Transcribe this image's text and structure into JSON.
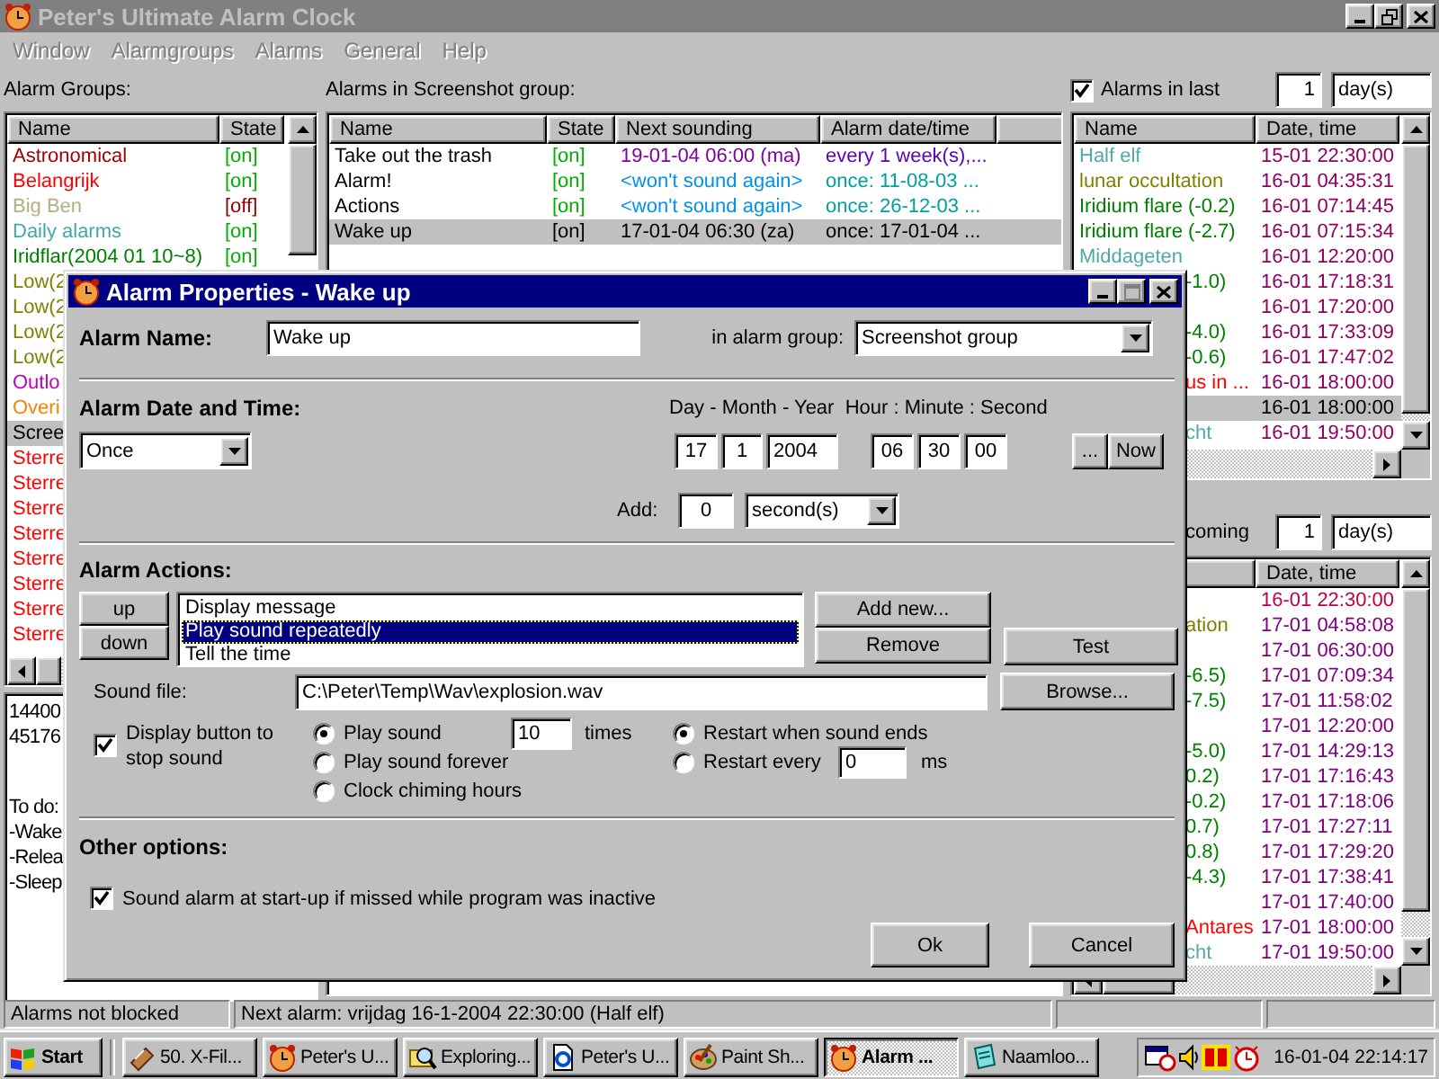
{
  "window": {
    "title": "Peter's Ultimate Alarm Clock",
    "active": false
  },
  "menu": [
    {
      "label": "Window",
      "disabled": true
    },
    {
      "label": "Alarmgroups",
      "disabled": true
    },
    {
      "label": "Alarms",
      "disabled": true
    },
    {
      "label": "General",
      "disabled": true
    },
    {
      "label": "Help",
      "disabled": true
    }
  ],
  "groups": {
    "label": "Alarm Groups:",
    "columns": [
      "Name",
      "State"
    ],
    "items": [
      {
        "name": "Astronomical",
        "color": "#a00000",
        "state": "[on]",
        "on": true,
        "selected": false
      },
      {
        "name": "Belangrijk",
        "color": "#ff0000",
        "state": "[on]",
        "on": true,
        "selected": false
      },
      {
        "name": "Big Ben",
        "color": "#b0b080",
        "state": "[off]",
        "on": false,
        "selected": false
      },
      {
        "name": "Daily alarms",
        "color": "#40a8a8",
        "state": "[on]",
        "on": true,
        "selected": false
      },
      {
        "name": "Iridflar(2004 01 10~8)",
        "color": "#008000",
        "state": "[on]",
        "on": true,
        "selected": false
      },
      {
        "name": "Low(2",
        "color": "#808000",
        "selected": false
      },
      {
        "name": "Low(2",
        "color": "#808000",
        "selected": false
      },
      {
        "name": "Low(2",
        "color": "#808000",
        "selected": false
      },
      {
        "name": "Low(2",
        "color": "#808000",
        "selected": false
      },
      {
        "name": "Outlo",
        "color": "#c000c0",
        "selected": false
      },
      {
        "name": "Overi",
        "color": "#ff8000",
        "selected": false
      },
      {
        "name": "Scree",
        "color": "#000000",
        "selected": true
      },
      {
        "name": "Sterre",
        "color": "#ff0000",
        "selected": false
      },
      {
        "name": "Sterre",
        "color": "#ff0000",
        "selected": false
      },
      {
        "name": "Sterre",
        "color": "#ff0000",
        "selected": false
      },
      {
        "name": "Sterre",
        "color": "#ff0000",
        "selected": false
      },
      {
        "name": "Sterre",
        "color": "#ff0000",
        "selected": false
      },
      {
        "name": "Sterre",
        "color": "#ff0000",
        "selected": false
      },
      {
        "name": "Sterre",
        "color": "#ff0000",
        "selected": false
      },
      {
        "name": "Sterre",
        "color": "#ff0000",
        "selected": false
      }
    ]
  },
  "notes": [
    [
      "14400",
      "45176"
    ],
    [
      "To do:",
      "-Wake",
      "-Relea",
      "-Sleep"
    ]
  ],
  "alarms": {
    "label": "Alarms in Screenshot group:",
    "columns": [
      "Name",
      "State",
      "Next sounding",
      "Alarm date/time"
    ],
    "rows": [
      {
        "name": "Take out the trash",
        "state": "[on]",
        "on": true,
        "next": {
          "text": "19-01-04 06:00 (ma)",
          "color": "#8000a0"
        },
        "date": {
          "text": "every 1 week(s),...",
          "color": "#6000c0"
        },
        "selected": false
      },
      {
        "name": "Alarm!",
        "state": "[on]",
        "on": true,
        "next": {
          "text": "<won't sound again>",
          "color": "#0090f0"
        },
        "date": {
          "text": "once: 11-08-03 ...",
          "color": "#00a0a0"
        },
        "selected": false
      },
      {
        "name": "Actions",
        "state": "[on]",
        "on": true,
        "next": {
          "text": "<won't sound again>",
          "color": "#0090f0"
        },
        "date": {
          "text": "once: 26-12-03 ...",
          "color": "#00a0a0"
        },
        "selected": false
      },
      {
        "name": "Wake up",
        "state": "[on]",
        "on": true,
        "next": {
          "text": "17-01-04 06:30 (za)",
          "color": "#000000"
        },
        "date": {
          "text": "once: 17-01-04 ...",
          "color": "#000000"
        },
        "selected": true
      }
    ]
  },
  "recent": {
    "checked": true,
    "label": "Alarms in last",
    "count": "1",
    "unit": "day(s)",
    "columns": [
      "Name",
      "Date, time"
    ],
    "rows": [
      {
        "name": "Half elf",
        "color": "#50a8a8",
        "time": {
          "text": "15-01 22:30:00",
          "color": "#900060"
        },
        "selected": false
      },
      {
        "name": "lunar occultation",
        "color": "#808000",
        "time": {
          "text": "16-01 04:35:31",
          "color": "#900060"
        },
        "selected": false
      },
      {
        "name": "Iridium flare (-0.2)",
        "color": "#008000",
        "time": {
          "text": "16-01 07:14:45",
          "color": "#900060"
        },
        "selected": false
      },
      {
        "name": "Iridium flare (-2.7)",
        "color": "#008000",
        "time": {
          "text": "16-01 07:15:34",
          "color": "#900060"
        },
        "selected": false
      },
      {
        "name": "Middageten",
        "color": "#50a8a8",
        "time": {
          "text": "16-01 12:20:00",
          "color": "#900060"
        },
        "selected": false
      },
      {
        "name": "-1.0)",
        "color": "#008000",
        "time": {
          "text": "16-01 17:18:31",
          "color": "#900060"
        },
        "selected": false
      },
      {
        "time": {
          "text": "16-01 17:20:00",
          "color": "#900060"
        },
        "selected": false
      },
      {
        "name": "-4.0)",
        "color": "#008000",
        "time": {
          "text": "16-01 17:33:09",
          "color": "#900060"
        },
        "selected": false
      },
      {
        "name": "-0.6)",
        "color": "#008000",
        "time": {
          "text": "16-01 17:47:02",
          "color": "#900060"
        },
        "selected": false
      },
      {
        "name": "us in ...",
        "color": "#ff0000",
        "time": {
          "text": "16-01 18:00:00",
          "color": "#900060"
        },
        "selected": false
      },
      {
        "time": {
          "text": "16-01 18:00:00",
          "color": "#000000"
        },
        "selected": true
      },
      {
        "name": "cht",
        "color": "#50a8a8",
        "time": {
          "text": "16-01 19:50:00",
          "color": "#900060"
        },
        "selected": false
      }
    ]
  },
  "upcoming": {
    "label": "coming",
    "count": "1",
    "unit": "day(s)",
    "columns": [
      "Date, time"
    ],
    "rows": [
      {
        "time": {
          "text": "16-01 22:30:00",
          "color": "#c00040"
        }
      },
      {
        "name": "ation",
        "color": "#808000",
        "time": {
          "text": "17-01 04:58:08",
          "color": "#800080"
        }
      },
      {
        "time": {
          "text": "17-01 06:30:00",
          "color": "#800080"
        }
      },
      {
        "name": "-6.5)",
        "color": "#008000",
        "time": {
          "text": "17-01 07:09:34",
          "color": "#800080"
        }
      },
      {
        "name": "-7.5)",
        "color": "#008000",
        "time": {
          "text": "17-01 11:58:02",
          "color": "#800080"
        }
      },
      {
        "time": {
          "text": "17-01 12:20:00",
          "color": "#800080"
        }
      },
      {
        "name": "-5.0)",
        "color": "#008000",
        "time": {
          "text": "17-01 14:29:13",
          "color": "#800080"
        }
      },
      {
        "name": "0.2)",
        "color": "#008000",
        "time": {
          "text": "17-01 17:16:43",
          "color": "#800080"
        }
      },
      {
        "name": "-0.2)",
        "color": "#008000",
        "time": {
          "text": "17-01 17:18:06",
          "color": "#800080"
        }
      },
      {
        "name": "0.7)",
        "color": "#008000",
        "time": {
          "text": "17-01 17:27:11",
          "color": "#800080"
        }
      },
      {
        "name": "0.8)",
        "color": "#008000",
        "time": {
          "text": "17-01 17:29:20",
          "color": "#800080"
        }
      },
      {
        "name": "-4.3)",
        "color": "#008000",
        "time": {
          "text": "17-01 17:38:41",
          "color": "#800080"
        }
      },
      {
        "time": {
          "text": "17-01 17:40:00",
          "color": "#800080"
        }
      },
      {
        "name": "Antares",
        "color": "#ff0000",
        "time": {
          "text": "17-01 18:00:00",
          "color": "#800080"
        }
      },
      {
        "name": "cht",
        "color": "#50a8a8",
        "time": {
          "text": "17-01 19:50:00",
          "color": "#800080"
        }
      }
    ]
  },
  "status_bar": [
    "Alarms not blocked",
    "Next alarm: vrijdag 16-1-2004 22:30:00 (Half elf)"
  ],
  "dialog": {
    "title": "Alarm Properties - Wake up",
    "name_label": "Alarm Name:",
    "name_value": "Wake up",
    "group_label": "in alarm group:",
    "group_value": "Screenshot group",
    "datetime_heading": "Alarm Date and Time:",
    "datetime_hint": "Day - Month - Year  Hour : Minute : Second",
    "repeat": "Once",
    "date": [
      "17",
      "1",
      "2004"
    ],
    "time": [
      "06",
      "30",
      "00"
    ],
    "pick_button": "...",
    "now_button": "Now",
    "add_label": "Add:",
    "add_value": "0",
    "add_unit": "second(s)",
    "actions_heading": "Alarm Actions:",
    "up_button": "up",
    "down_button": "down",
    "actions": [
      {
        "label": "Display message",
        "selected": false
      },
      {
        "label": "Play sound repeatedly",
        "selected": true
      },
      {
        "label": "Tell the time",
        "selected": false
      }
    ],
    "add_button": "Add new...",
    "remove_button": "Remove",
    "test_button": "Test",
    "sound_label": "Sound file:",
    "sound_value": "C:\\Peter\\Temp\\Wav\\explosion.wav",
    "browse_button": "Browse...",
    "stop_button": {
      "label": "Display button to stop sound",
      "checked": true
    },
    "play_modes": [
      {
        "label": "Play sound",
        "selected": true
      },
      {
        "label": "Play sound forever",
        "selected": false
      },
      {
        "label": "Clock chiming hours",
        "selected": false
      }
    ],
    "times_value": "10",
    "times_label": "times",
    "restart_modes": [
      {
        "label": "Restart when sound ends",
        "selected": true
      },
      {
        "label": "Restart every",
        "selected": false
      }
    ],
    "restart_value": "0",
    "restart_unit": "ms",
    "other_heading": "Other options:",
    "startup": {
      "label": "Sound alarm at start-up if missed while program was inactive",
      "checked": true
    },
    "ok_button": "Ok",
    "cancel_button": "Cancel"
  },
  "taskbar": {
    "start": "Start",
    "tasks": [
      {
        "kind": "tape",
        "label": "50. X-Fil...",
        "selected": false
      },
      {
        "kind": "clock",
        "label": "Peter's U...",
        "selected": false
      },
      {
        "kind": "magnifier",
        "label": "Exploring...",
        "selected": false
      },
      {
        "kind": "browser",
        "label": "Peter's U...",
        "selected": false
      },
      {
        "kind": "palette",
        "label": "Paint Sh...",
        "selected": false
      },
      {
        "kind": "clock",
        "label": "Alarm ...",
        "selected": true
      },
      {
        "kind": "notebook",
        "label": "Naamloo...",
        "selected": false
      }
    ],
    "clock": "16-01-04 22:14:17"
  }
}
